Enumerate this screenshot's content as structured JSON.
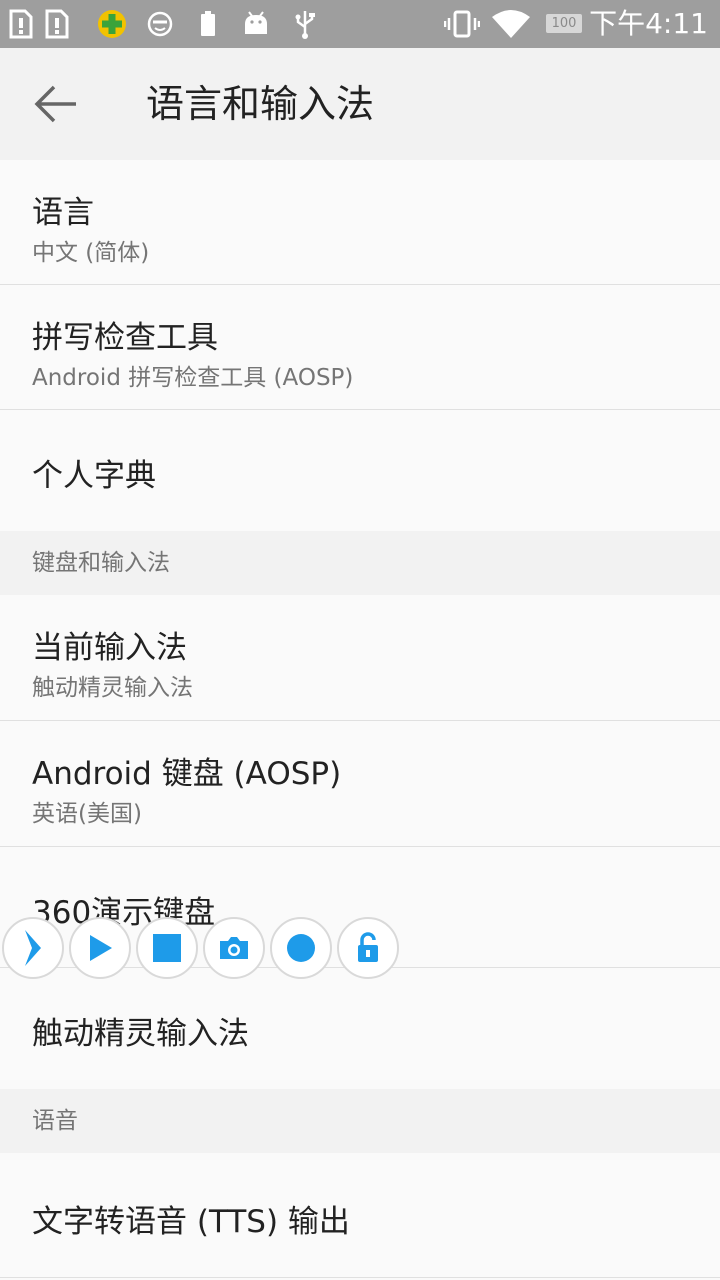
{
  "status_bar": {
    "time": "下午4:11",
    "battery_level": "100",
    "icons": [
      "sim-alert-icon",
      "sim-alert-icon",
      "360-security-icon",
      "face-icon",
      "battery-icon",
      "android-debug-icon",
      "usb-icon",
      "vibrate-icon",
      "wifi-icon"
    ]
  },
  "toolbar": {
    "title": "语言和输入法"
  },
  "items": {
    "language": {
      "title": "语言",
      "summary": "中文 (简体)"
    },
    "spellcheck": {
      "title": "拼写检查工具",
      "summary": "Android 拼写检查工具 (AOSP)"
    },
    "dictionary": {
      "title": "个人字典"
    },
    "section_keyboard": "键盘和输入法",
    "current_ime": {
      "title": "当前输入法",
      "summary": "触动精灵输入法"
    },
    "android_kb": {
      "title": "Android 键盘 (AOSP)",
      "summary": "英语(美国)"
    },
    "demo_kb": {
      "title": "360演示键盘"
    },
    "touch_ime": {
      "title": "触动精灵输入法"
    },
    "section_voice": "语音",
    "tts": {
      "title": "文字转语音 (TTS) 输出"
    }
  },
  "floating_toolbar": {
    "accent": "#1e9be9",
    "buttons": [
      "collapse-chevron-icon",
      "play-icon",
      "stop-icon",
      "camera-icon",
      "record-icon",
      "unlock-icon"
    ]
  }
}
